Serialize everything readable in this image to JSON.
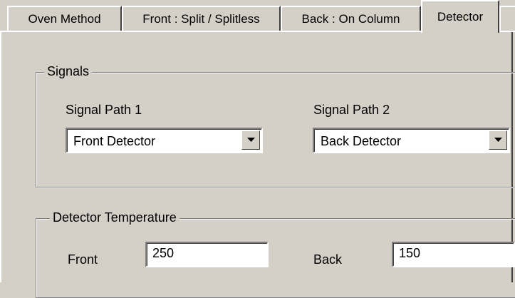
{
  "tabs": [
    {
      "label": "Oven Method",
      "active": false
    },
    {
      "label": "Front : Split / Splitless",
      "active": false
    },
    {
      "label": "Back : On Column",
      "active": false
    },
    {
      "label": "Detector",
      "active": true
    }
  ],
  "signals": {
    "title": "Signals",
    "path1": {
      "label": "Signal Path 1",
      "value": "Front Detector"
    },
    "path2": {
      "label": "Signal Path 2",
      "value": "Back Detector"
    }
  },
  "detector_temperature": {
    "title": "Detector Temperature",
    "front": {
      "label": "Front",
      "value": "250"
    },
    "back": {
      "label": "Back",
      "value": "150"
    }
  },
  "icons": {
    "combo_button": "dropdown-arrow-icon"
  },
  "colors": {
    "face": "#d4d0c8",
    "field": "#ffffff",
    "shadow": "#808080",
    "dark_shadow": "#404040",
    "highlight": "#ffffff"
  }
}
